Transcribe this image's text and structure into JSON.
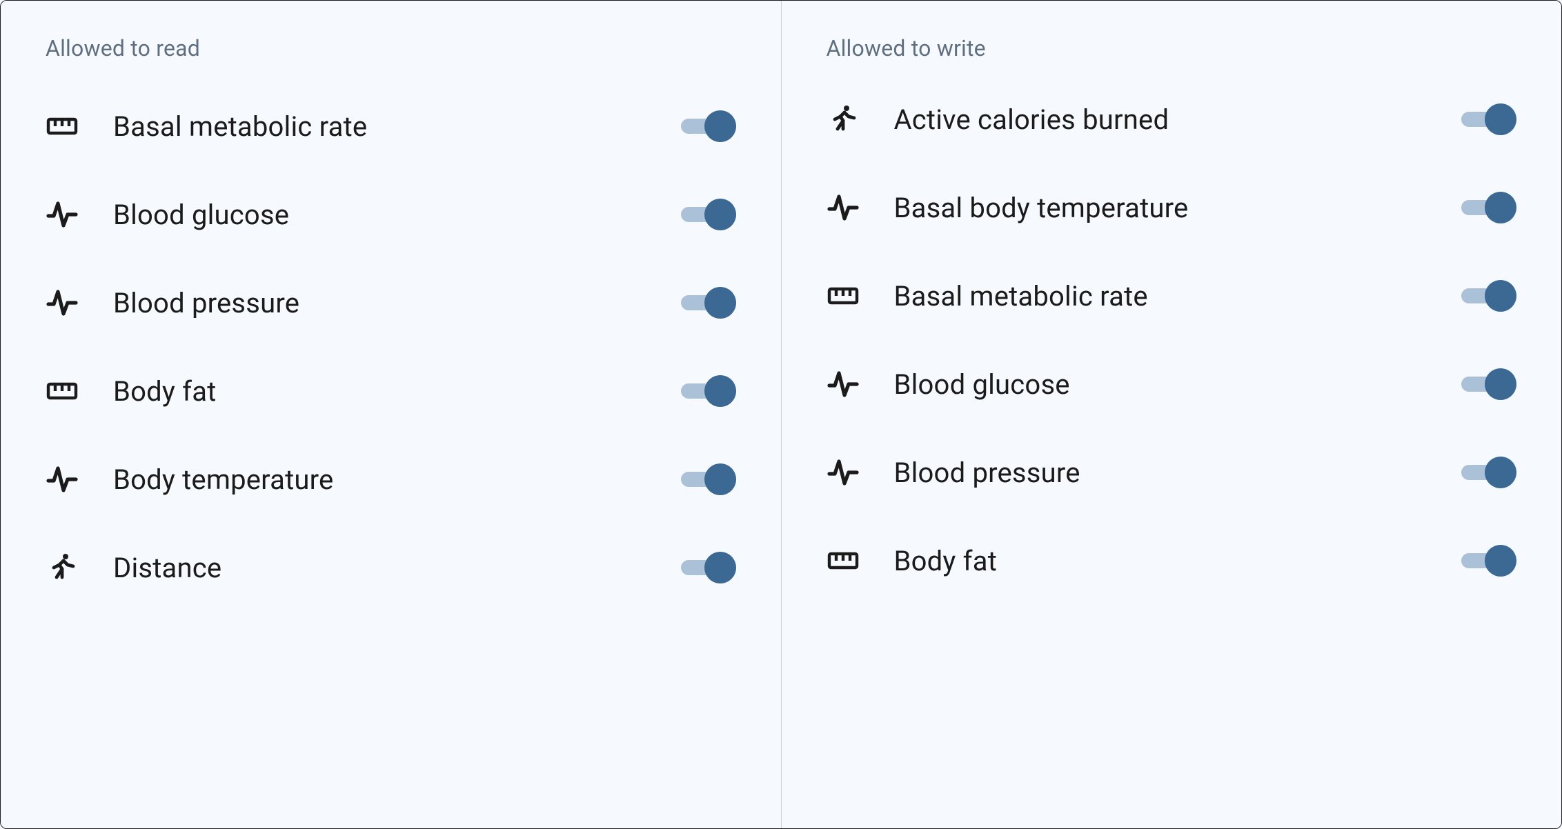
{
  "left": {
    "title": "Allowed to read",
    "items": [
      {
        "icon": "ruler",
        "label": "Basal metabolic rate",
        "on": true
      },
      {
        "icon": "pulse",
        "label": "Blood glucose",
        "on": true
      },
      {
        "icon": "pulse",
        "label": "Blood pressure",
        "on": true
      },
      {
        "icon": "ruler",
        "label": "Body fat",
        "on": true
      },
      {
        "icon": "pulse",
        "label": "Body temperature",
        "on": true
      },
      {
        "icon": "run",
        "label": "Distance",
        "on": true
      }
    ]
  },
  "right": {
    "title": "Allowed to write",
    "items": [
      {
        "icon": "run",
        "label": "Active calories burned",
        "on": true
      },
      {
        "icon": "pulse",
        "label": "Basal body temperature",
        "on": true
      },
      {
        "icon": "ruler",
        "label": "Basal metabolic rate",
        "on": true
      },
      {
        "icon": "pulse",
        "label": "Blood glucose",
        "on": true
      },
      {
        "icon": "pulse",
        "label": "Blood pressure",
        "on": true
      },
      {
        "icon": "ruler",
        "label": "Body fat",
        "on": true
      }
    ]
  }
}
